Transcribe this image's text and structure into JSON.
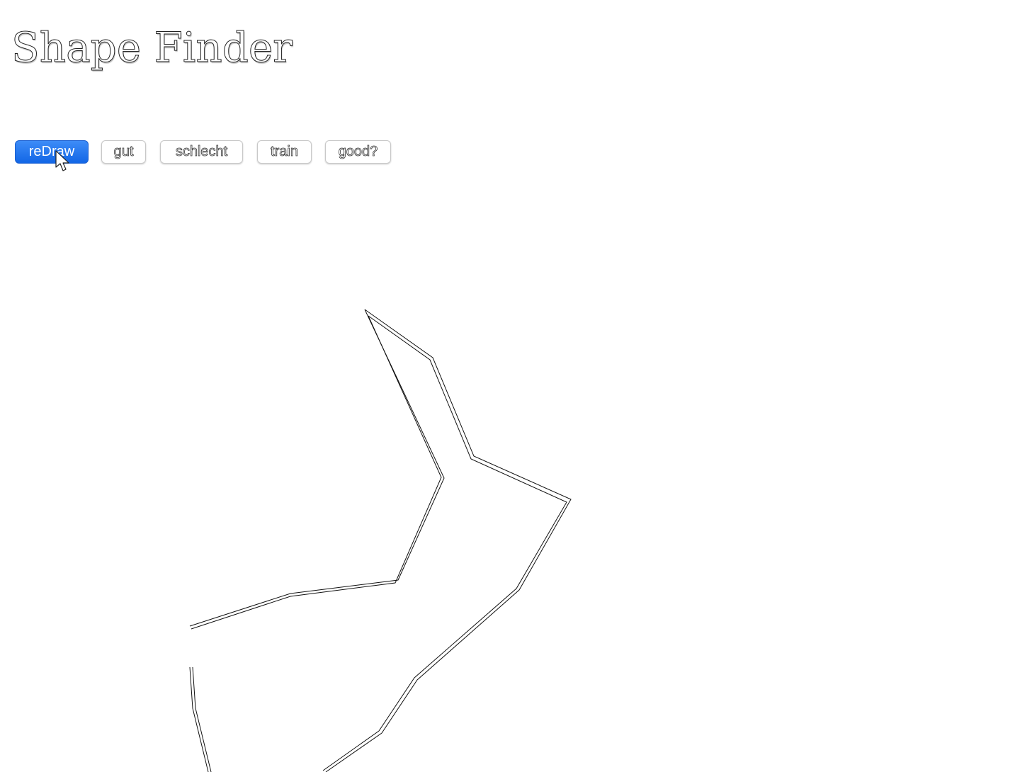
{
  "header": {
    "title": "Shape Finder"
  },
  "toolbar": {
    "redraw_label": "reDraw",
    "gut_label": "gut",
    "schlecht_label": "schlecht",
    "train_label": "train",
    "good_label": "good?"
  },
  "colors": {
    "primary_button": "#1a6ef0",
    "shape_stroke": "#111111"
  },
  "icons": {
    "cursor": "arrow-cursor-icon"
  }
}
